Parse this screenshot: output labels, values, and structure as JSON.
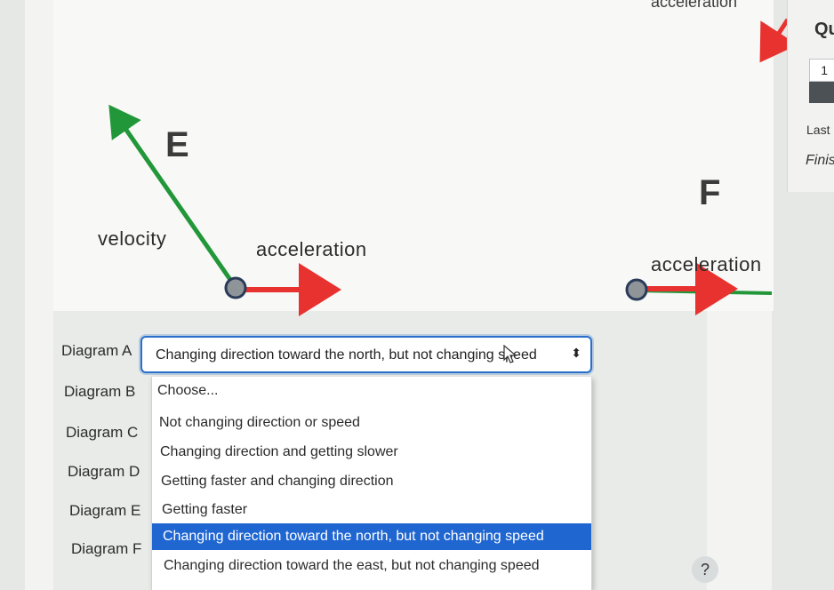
{
  "diagrams": {
    "d_acceleration_label": "acceleration",
    "e_letter": "E",
    "e_velocity_label": "velocity",
    "e_acceleration_label": "acceleration",
    "f_letter": "F",
    "f_acceleration_label": "acceleration"
  },
  "rows": [
    "Diagram A",
    "Diagram B",
    "Diagram C",
    "Diagram D",
    "Diagram E",
    "Diagram F"
  ],
  "select": {
    "value": "Changing direction toward the north, but not changing speed",
    "options": [
      "Choose...",
      "Not changing direction or speed",
      "Changing direction and getting slower",
      "Getting faster and changing direction",
      "Getting faster",
      "Changing direction toward the north, but not changing speed",
      "Changing direction toward the east, but not changing speed"
    ]
  },
  "side": {
    "title": "Qu",
    "question_number": "1",
    "last": "Last",
    "finish": "Finis"
  },
  "help": {
    "symbol": "?"
  },
  "colors": {
    "velocity": "#22973a",
    "acceleration": "#e8322f",
    "selected_option": "#1f66d1",
    "focus_border": "#2a6fc9"
  }
}
